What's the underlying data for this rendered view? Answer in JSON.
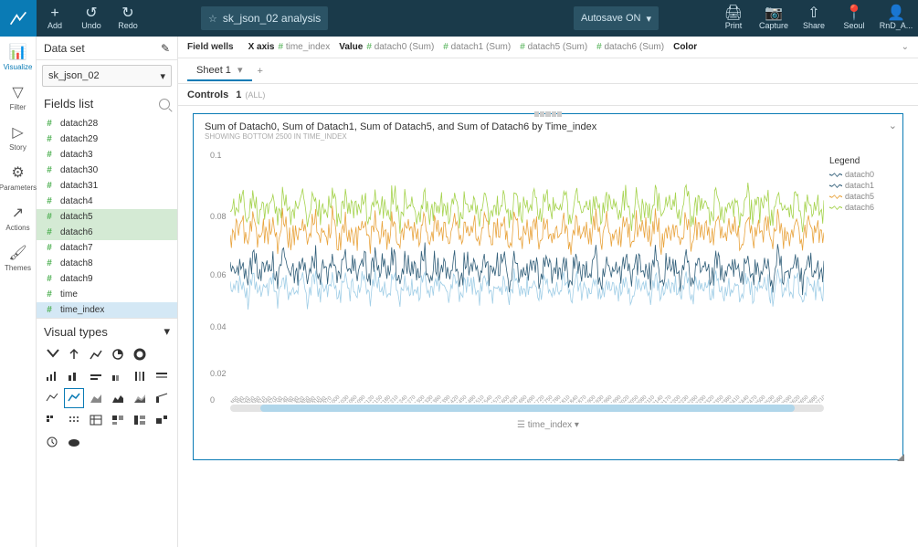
{
  "topbar": {
    "add_label": "Add",
    "undo_label": "Undo",
    "redo_label": "Redo",
    "analysis_title": "sk_json_02 analysis",
    "autosave_label": "Autosave ON",
    "right": {
      "print": "Print",
      "capture": "Capture",
      "share": "Share",
      "seoul": "Seoul",
      "user": "RnD_A..."
    }
  },
  "leftrail": {
    "items": [
      {
        "label": "Visualize"
      },
      {
        "label": "Filter"
      },
      {
        "label": "Story"
      },
      {
        "label": "Parameters"
      },
      {
        "label": "Actions"
      },
      {
        "label": "Themes"
      }
    ]
  },
  "sidepanel": {
    "section": "Data set",
    "dataset": "sk_json_02",
    "fields_title": "Fields list",
    "fields": [
      {
        "name": "datach28",
        "selected": false
      },
      {
        "name": "datach29",
        "selected": false
      },
      {
        "name": "datach3",
        "selected": false
      },
      {
        "name": "datach30",
        "selected": false
      },
      {
        "name": "datach31",
        "selected": false
      },
      {
        "name": "datach4",
        "selected": false
      },
      {
        "name": "datach5",
        "selected": true
      },
      {
        "name": "datach6",
        "selected": true
      },
      {
        "name": "datach7",
        "selected": false
      },
      {
        "name": "datach8",
        "selected": false
      },
      {
        "name": "datach9",
        "selected": false
      },
      {
        "name": "time",
        "selected": false
      },
      {
        "name": "time_index",
        "selected": false,
        "blue": true
      }
    ],
    "visual_types_title": "Visual types"
  },
  "fieldwells": {
    "title": "Field wells",
    "xaxis_label": "X axis",
    "xaxis_value": "time_index",
    "value_label": "Value",
    "values": [
      "datach0 (Sum)",
      "datach1 (Sum)",
      "datach5 (Sum)",
      "datach6 (Sum)"
    ],
    "color_label": "Color"
  },
  "tabs": {
    "items": [
      {
        "label": "Sheet 1"
      }
    ]
  },
  "controls": {
    "title": "Controls",
    "count": "1",
    "all": "(ALL)"
  },
  "chart": {
    "title": "Sum of Datach0, Sum of Datach1, Sum of Datach5, and Sum of Datach6 by Time_index",
    "subtitle": "SHOWING BOTTOM 2500 IN TIME_INDEX",
    "legend_title": "Legend",
    "legend_items": [
      {
        "name": "datach0",
        "color": "#2f5d78"
      },
      {
        "name": "datach1",
        "color": "#2f5d78"
      },
      {
        "name": "datach5",
        "color": "#e8a23a"
      },
      {
        "name": "datach6",
        "color": "#a4d24b"
      }
    ],
    "xlabel": "time_index",
    "y_ticks": [
      {
        "v": "0.1",
        "pct": 0
      },
      {
        "v": "0.08",
        "pct": 25
      },
      {
        "v": "0.06",
        "pct": 49
      },
      {
        "v": "0.04",
        "pct": 70
      },
      {
        "v": "0.02",
        "pct": 89
      },
      {
        "v": "0",
        "pct": 100
      }
    ]
  },
  "chart_data": {
    "type": "line",
    "title": "Sum of Datach0, Sum of Datach1, Sum of Datach5, and Sum of Datach6 by Time_index",
    "xlabel": "time_index",
    "ylabel": "",
    "ylim": [
      0,
      0.1
    ],
    "note": "dense noisy series ~2500 points; values below approximate band centers and amplitudes",
    "series": [
      {
        "name": "datach6",
        "color": "#a4d24b",
        "center": 0.077,
        "amplitude": 0.01
      },
      {
        "name": "datach5",
        "color": "#e8a23a",
        "center": 0.067,
        "amplitude": 0.01
      },
      {
        "name": "datach1",
        "color": "#2f5d78",
        "center": 0.052,
        "amplitude": 0.01
      },
      {
        "name": "datach0",
        "color": "#9fcde6",
        "center": 0.044,
        "amplitude": 0.008
      }
    ]
  }
}
